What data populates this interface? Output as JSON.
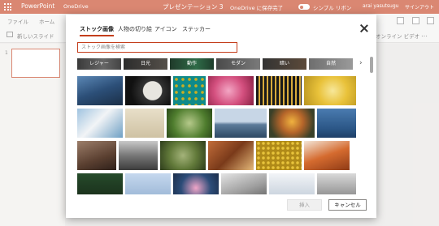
{
  "app": {
    "name": "PowerPoint",
    "onedrive": "OneDrive",
    "doc_title": "プレゼンテーション 3",
    "save_status": "OneDrive に保存完了",
    "simple_ribbon": "シンプル リボン",
    "user": "arai yasutsugu",
    "sign_out": "サインアウト",
    "accent": "#c43e1c"
  },
  "ribbon": {
    "tabs": [
      "ファイル",
      "ホーム"
    ],
    "new_slide": "新しいスライド",
    "online_video": "オンライン ビデオ",
    "more": "…"
  },
  "slides": {
    "current_number": "1"
  },
  "dialog": {
    "tabs": [
      {
        "label": "ストック画像",
        "active": true
      },
      {
        "label": "人物の切り絵",
        "active": false
      },
      {
        "label": "アイコン",
        "active": false
      },
      {
        "label": "ステッカー",
        "active": false
      }
    ],
    "search_placeholder": "ストック画像を検索",
    "categories": [
      "レジャー",
      "日光",
      "動作",
      "モダン",
      "暗い",
      "自然"
    ],
    "insert_label": "挿入",
    "cancel_label": "キャンセル"
  }
}
